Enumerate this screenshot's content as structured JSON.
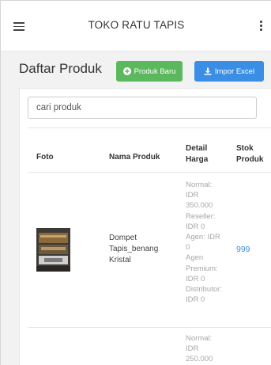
{
  "topbar": {
    "title": "TOKO RATU TAPIS",
    "menu_icon": "hamburger-icon",
    "more_icon": "kebab-menu-icon"
  },
  "page": {
    "title": "Daftar Produk",
    "new_button": "Produk Baru",
    "new_button_icon": "plus-circle-icon",
    "import_button": "Impor Excel",
    "import_button_icon": "download-icon"
  },
  "search": {
    "placeholder": "cari produk"
  },
  "table": {
    "headers": {
      "photo": "Foto",
      "name": "Nama Produk",
      "detail_line1": "Detail",
      "detail_line2": "Harga",
      "stock_line1": "Stok",
      "stock_line2": "Produk"
    },
    "rows": [
      {
        "name_lines": [
          "Dompet",
          "Tapis_benang",
          "Kristal"
        ],
        "detail_lines": [
          "Normal:",
          "IDR",
          "350.000",
          "Reseller:",
          "IDR 0",
          "Agen: IDR",
          "0",
          "Agen",
          "Premium:",
          "IDR 0",
          "Distributor:",
          "IDR 0"
        ],
        "stock": "999"
      },
      {
        "detail_lines": [
          "Normal:",
          "IDR",
          "250.000"
        ]
      }
    ]
  },
  "colors": {
    "green": "#5cb85c",
    "blue": "#3a8ee6",
    "muted": "#a7a7a7"
  }
}
